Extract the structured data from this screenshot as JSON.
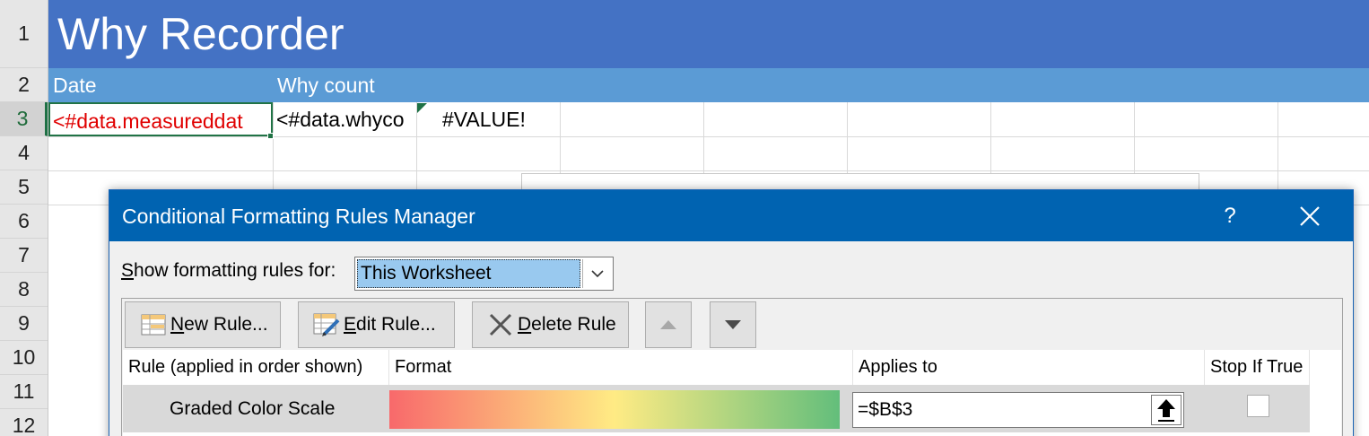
{
  "sheet": {
    "row_numbers": [
      "1",
      "2",
      "3",
      "4",
      "5",
      "6",
      "7",
      "8",
      "9",
      "10",
      "11",
      "12"
    ],
    "active_row": "3",
    "title": "Why Recorder",
    "headers": {
      "col_a": "Date",
      "col_b": "Why count"
    },
    "row3": {
      "a": "<#data.measureddat",
      "b": "<#data.whyco",
      "c": "#VALUE!"
    },
    "colors": {
      "title_band": "#4472c4",
      "header_band": "#5b9bd5",
      "selection": "#217346",
      "template_text": "#e00000"
    }
  },
  "dialog": {
    "title": "Conditional Formatting Rules Manager",
    "help_glyph": "?",
    "show_label_prefix": "S",
    "show_label_rest": "how formatting rules for:",
    "scope_value": "This Worksheet",
    "toolbar": {
      "new_rule": {
        "key": "N",
        "rest": "ew Rule..."
      },
      "edit_rule": {
        "key": "E",
        "rest": "dit Rule..."
      },
      "delete_rule": {
        "key": "D",
        "rest": "elete Rule"
      }
    },
    "columns": {
      "rule": "Rule (applied in order shown)",
      "format": "Format",
      "applies_to": "Applies to",
      "stop_if_true": "Stop If True"
    },
    "rules": [
      {
        "name": "Graded Color Scale",
        "format_colors": [
          "#f8696b",
          "#ffeb84",
          "#63be7b"
        ],
        "applies_to": "=$B$3",
        "stop_if_true": false
      }
    ],
    "colors": {
      "titlebar": "#0063b1",
      "scope_highlight": "#99c9ef"
    }
  }
}
